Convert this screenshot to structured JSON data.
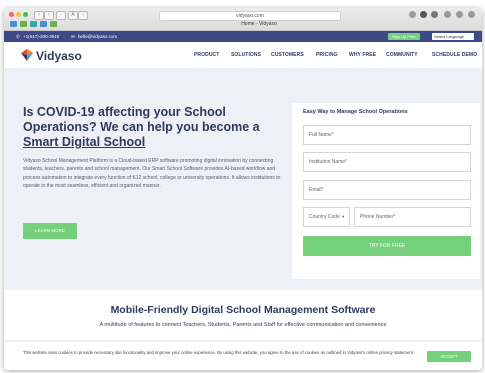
{
  "browser": {
    "address": "vidyaso.com",
    "tab_title": "Home - Vidyaso"
  },
  "topbar": {
    "phone": "+1(647)-200-3918",
    "email": "hello@vidyaso.com",
    "signup_label": "Sign Up Free",
    "language": "Select Language"
  },
  "nav": {
    "brand": "Vidyaso",
    "items": [
      "PRODUCT",
      "SOLUTIONS",
      "CUSTOMERS",
      "PRICING",
      "WHY FREE",
      "COMMUNITY",
      "SCHEDULE DEMO"
    ]
  },
  "hero": {
    "title_line1": "Is COVID-19 affecting your School",
    "title_line2": "Operations? We can help you become a",
    "title_line3": "Smart Digital School",
    "paragraph": "Vidyaso School Management Platform is a Cloud-based ERP software promoting digital innovation by connecting students, teachers, parents and school management. Our Smart School Software provides AI-based workflow and process automation to integrate every function of K12 school, college or university operations. It allows institutions to operate in the most seamless, efficient and organized manner.",
    "learn_more": "LEARN MORE"
  },
  "form": {
    "title": "Easy Way to Manage School Operations",
    "full_name": "Full Name*",
    "institution": "Institution Name*",
    "email": "Email*",
    "country_code": "Country Code",
    "phone": "Phone Number*",
    "submit": "TRY FOR FREE"
  },
  "features": {
    "title": "Mobile-Friendly Digital School Management Software",
    "subtitle": "A multitude of features to connect Teachers, Students, Parents and Staff for effective communication and convenience"
  },
  "cookie": {
    "text": "This website uses cookies to provide necessary site functionality and improve your online experience. By using this website, you agree to the use of cookies as outlined in Vidyaso's online privacy statement.",
    "accept": "ACCEPT"
  },
  "colors": {
    "brand_navy": "#2f3a5c",
    "topbar": "#3d4a86",
    "accent_green": "#74d07a",
    "hero_bg": "#eef0f7"
  }
}
